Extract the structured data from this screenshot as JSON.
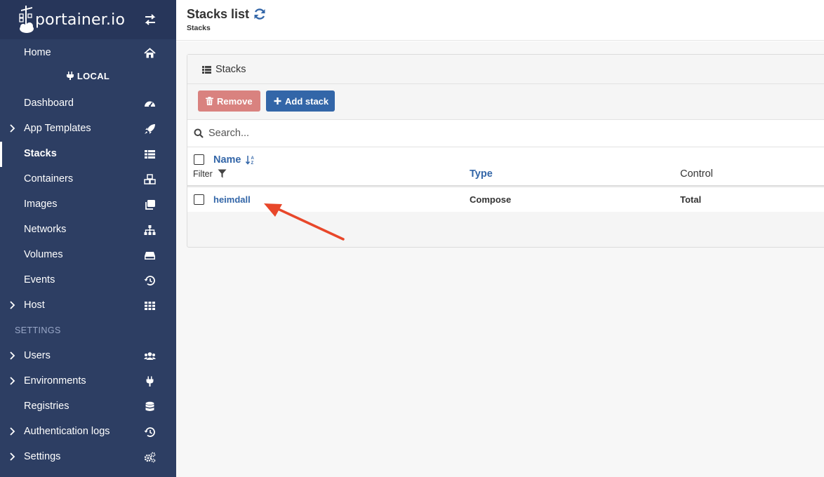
{
  "brand": {
    "logo_text": "portainer.io"
  },
  "sidebar": {
    "home": {
      "label": "Home",
      "icon": "home-icon"
    },
    "environment_label": "LOCAL",
    "items": [
      {
        "label": "Dashboard",
        "icon": "tachometer-icon",
        "expandable": false
      },
      {
        "label": "App Templates",
        "icon": "rocket-icon",
        "expandable": true
      },
      {
        "label": "Stacks",
        "icon": "th-list-icon",
        "expandable": false,
        "active": true
      },
      {
        "label": "Containers",
        "icon": "cubes-icon",
        "expandable": false
      },
      {
        "label": "Images",
        "icon": "clone-icon",
        "expandable": false
      },
      {
        "label": "Networks",
        "icon": "sitemap-icon",
        "expandable": false
      },
      {
        "label": "Volumes",
        "icon": "hdd-icon",
        "expandable": false
      },
      {
        "label": "Events",
        "icon": "history-icon",
        "expandable": false
      },
      {
        "label": "Host",
        "icon": "th-icon",
        "expandable": true
      }
    ],
    "settings_title": "SETTINGS",
    "settings_items": [
      {
        "label": "Users",
        "icon": "users-icon",
        "expandable": true
      },
      {
        "label": "Environments",
        "icon": "plug-icon",
        "expandable": true
      },
      {
        "label": "Registries",
        "icon": "database-icon",
        "expandable": false
      },
      {
        "label": "Authentication logs",
        "icon": "history-icon",
        "expandable": true
      },
      {
        "label": "Settings",
        "icon": "cogs-icon",
        "expandable": true
      }
    ]
  },
  "header": {
    "title": "Stacks list",
    "breadcrumb": "Stacks"
  },
  "panel": {
    "title": "Stacks",
    "remove_label": "Remove",
    "add_label": "Add stack",
    "search_placeholder": "Search...",
    "columns": {
      "name": "Name",
      "filter": "Filter",
      "type": "Type",
      "control": "Control"
    },
    "rows": [
      {
        "name": "heimdall",
        "type": "Compose",
        "control": "Total"
      }
    ]
  },
  "colors": {
    "sidebar_bg": "#2d3e63",
    "accent": "#3366a8",
    "danger": "#d9827f",
    "annotation_arrow": "#e8472a"
  }
}
